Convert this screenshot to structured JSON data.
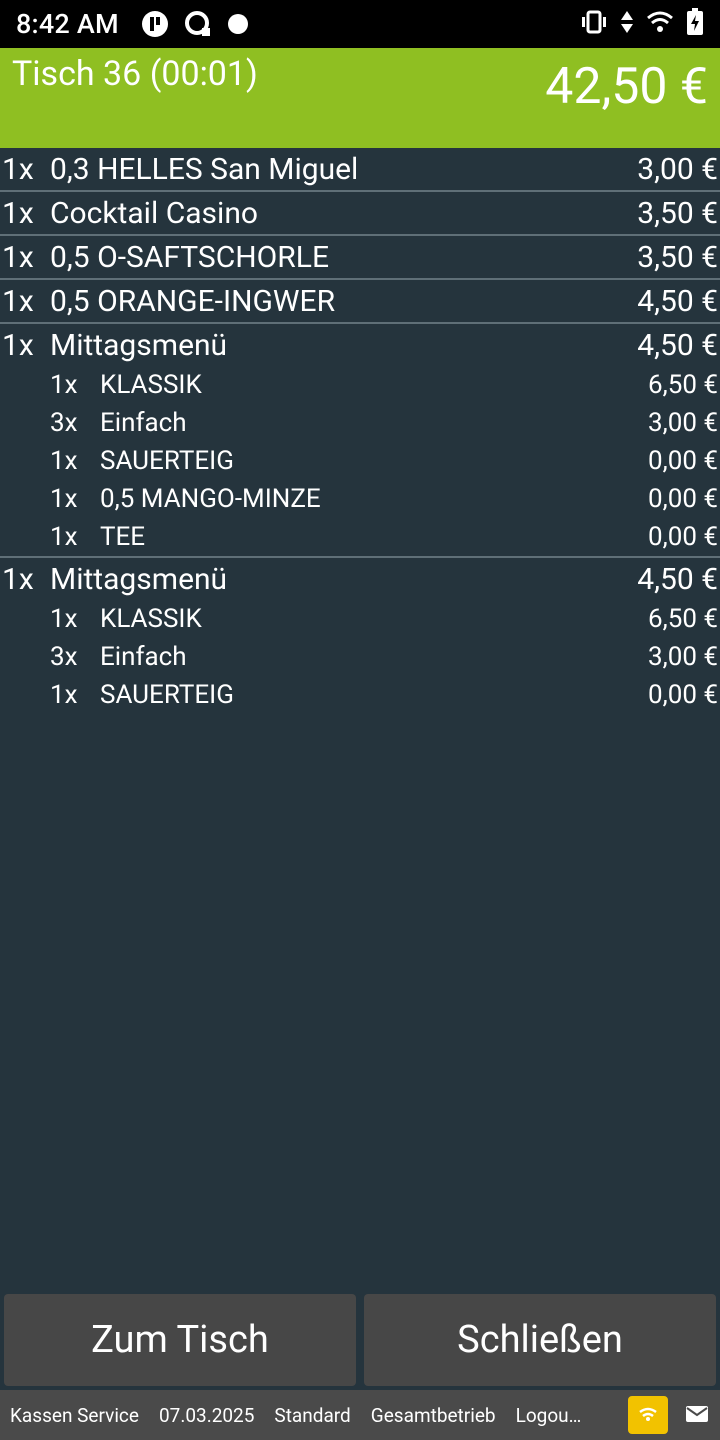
{
  "status_bar": {
    "time": "8:42 AM",
    "icons_left": [
      "app-badge-icon",
      "sync-icon",
      "dot-icon"
    ],
    "icons_right": [
      "vibrate-icon",
      "data-arrows-icon",
      "wifi-icon",
      "battery-charging-icon"
    ]
  },
  "header": {
    "title": "Tisch 36 (00:01)",
    "total": "42,50 €",
    "color": "#8fbf22"
  },
  "orders": [
    {
      "qty": "1x",
      "name": "0,3 HELLES San Miguel",
      "price": "3,00 €",
      "subitems": []
    },
    {
      "qty": "1x",
      "name": "Cocktail Casino",
      "price": "3,50 €",
      "subitems": []
    },
    {
      "qty": "1x",
      "name": "0,5 O-SAFTSCHORLE",
      "price": "3,50 €",
      "subitems": []
    },
    {
      "qty": "1x",
      "name": "0,5 ORANGE-INGWER",
      "price": "4,50 €",
      "subitems": []
    },
    {
      "qty": "1x",
      "name": "Mittagsmenü",
      "price": "4,50 €",
      "subitems": [
        {
          "qty": "1x",
          "name": "KLASSIK",
          "price": "6,50 €"
        },
        {
          "qty": "3x",
          "name": "Einfach",
          "price": "3,00 €"
        },
        {
          "qty": "1x",
          "name": "SAUERTEIG",
          "price": "0,00 €"
        },
        {
          "qty": "1x",
          "name": "0,5 MANGO-MINZE",
          "price": "0,00 €"
        },
        {
          "qty": "1x",
          "name": "TEE",
          "price": "0,00 €"
        }
      ]
    },
    {
      "qty": "1x",
      "name": "Mittagsmenü",
      "price": "4,50 €",
      "subitems": [
        {
          "qty": "1x",
          "name": "KLASSIK",
          "price": "6,50 €"
        },
        {
          "qty": "3x",
          "name": "Einfach",
          "price": "3,00 €"
        },
        {
          "qty": "1x",
          "name": "SAUERTEIG",
          "price": "0,00 €"
        }
      ]
    }
  ],
  "buttons": {
    "to_table": "Zum Tisch",
    "close": "Schließen"
  },
  "footer": {
    "user": "Kassen Service",
    "date": "07.03.2025",
    "mode": "Standard",
    "area": "Gesamtbetrieb",
    "logout": "Logou…",
    "wifi_icon": "wifi-icon",
    "mail_icon": "mail-icon",
    "wifi_button_color": "#f2c200"
  }
}
